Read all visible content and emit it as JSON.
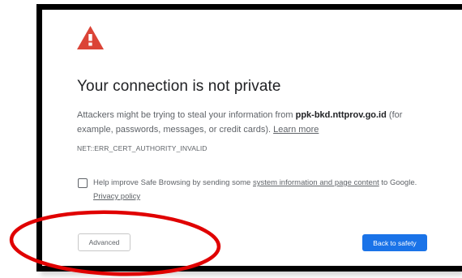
{
  "icon": {
    "warning": "warning-triangle-icon",
    "color": "#db4437"
  },
  "interstitial": {
    "title": "Your connection is not private",
    "message_prefix": "Attackers might be trying to steal your information from ",
    "domain": "ppk-bkd.nttprov.go.id",
    "message_suffix": " (for example, passwords, messages, or credit cards). ",
    "learn_more": "Learn more",
    "error_code": "NET::ERR_CERT_AUTHORITY_INVALID"
  },
  "safe_browsing": {
    "checked": false,
    "text_prefix": "Help improve Safe Browsing by sending some ",
    "link": "system information and page content",
    "text_suffix": " to Google.",
    "privacy_link": "Privacy policy"
  },
  "buttons": {
    "advanced": "Advanced",
    "back": "Back to safety"
  },
  "colors": {
    "primary": "#1a73e8",
    "annotation": "#e00000"
  }
}
